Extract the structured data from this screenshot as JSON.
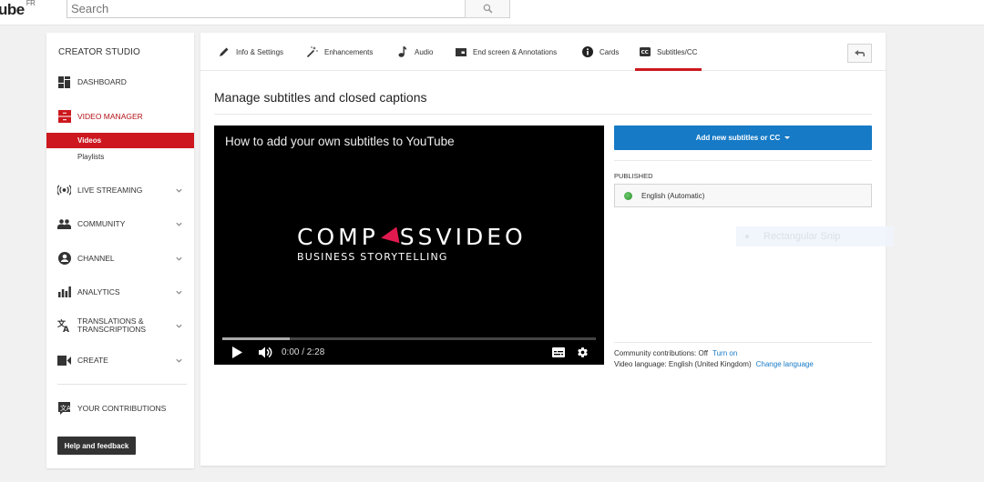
{
  "topbar": {
    "logo_text": "ube",
    "logo_region": "FR",
    "search_placeholder": "Search"
  },
  "sidebar": {
    "title": "CREATOR STUDIO",
    "items": [
      {
        "label": "DASHBOARD",
        "icon": "dashboard-icon"
      },
      {
        "label": "VIDEO MANAGER",
        "icon": "video-manager-icon",
        "active": true
      },
      {
        "label": "LIVE STREAMING",
        "icon": "live-streaming-icon"
      },
      {
        "label": "COMMUNITY",
        "icon": "community-icon"
      },
      {
        "label": "CHANNEL",
        "icon": "channel-icon"
      },
      {
        "label": "ANALYTICS",
        "icon": "analytics-icon"
      },
      {
        "label": "TRANSLATIONS &\nTRANSCRIPTIONS",
        "label_line1": "TRANSLATIONS &",
        "label_line2": "TRANSCRIPTIONS",
        "icon": "translate-icon"
      },
      {
        "label": "CREATE",
        "icon": "create-camera-icon"
      }
    ],
    "subitems": [
      {
        "label": "Videos",
        "active": true
      },
      {
        "label": "Playlists"
      }
    ],
    "contributions_label": "YOUR CONTRIBUTIONS",
    "help_label": "Help and feedback"
  },
  "tabs": [
    {
      "label": "Info & Settings",
      "icon": "pencil-icon"
    },
    {
      "label": "Enhancements",
      "icon": "magic-wand-icon"
    },
    {
      "label": "Audio",
      "icon": "music-note-icon"
    },
    {
      "label": "End screen & Annotations",
      "icon": "end-screen-icon"
    },
    {
      "label": "Cards",
      "icon": "info-icon"
    },
    {
      "label": "Subtitles/CC",
      "icon": "cc-icon",
      "active": true
    }
  ],
  "main": {
    "page_title": "Manage subtitles and closed captions",
    "video": {
      "title": "How to add your own subtitles to YouTube",
      "brand_left": "COMP",
      "brand_right": "SSVIDEO",
      "brand_sub": "BUSINESS STORYTELLING",
      "current_time": "0:00",
      "duration": "2:28",
      "time_display": "0:00 / 2:28",
      "buffered_fraction": 0.18
    },
    "add_button_label": "Add new subtitles or CC",
    "published_heading": "PUBLISHED",
    "published_tracks": [
      {
        "label": "English (Automatic)",
        "status_color": "#3a9a3a"
      }
    ],
    "overlay_snip_label": "Rectangular Snip",
    "community_contributions_label": "Community contributions: Off",
    "community_contributions_link": "Turn on",
    "video_language_label": "Video language: English (United Kingdom)",
    "video_language_link": "Change language"
  },
  "colors": {
    "accent_red": "#cc181e",
    "primary_blue": "#167ac6",
    "help_button_bg": "#333333"
  }
}
